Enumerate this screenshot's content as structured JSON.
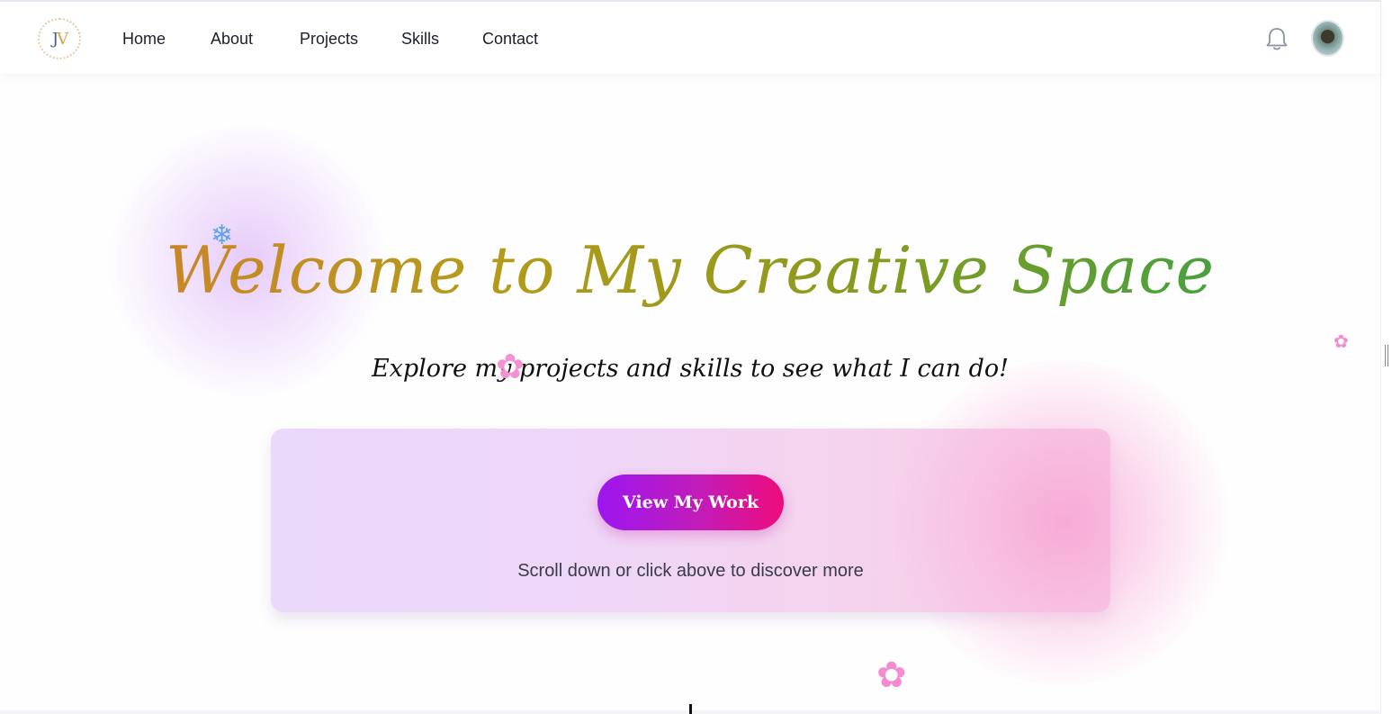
{
  "navbar": {
    "logo_text_j": "J",
    "logo_text_v": "V",
    "links": [
      {
        "label": "Home"
      },
      {
        "label": "About"
      },
      {
        "label": "Projects"
      },
      {
        "label": "Skills"
      },
      {
        "label": "Contact"
      }
    ],
    "notification_icon": "bell-icon",
    "avatar_icon": "user-avatar"
  },
  "hero": {
    "title": "Welcome to My Creative Space",
    "subtitle": "Explore my projects and skills to see what I can do!"
  },
  "cta": {
    "button_label": "View My Work",
    "hint": "Scroll down or click above to discover more"
  },
  "decorations": {
    "snowflake": "❄",
    "flower": "✿"
  },
  "colors": {
    "title_gradient_start": "#d27c2e",
    "title_gradient_end": "#3aa04a",
    "button_gradient_start": "#9b16f0",
    "button_gradient_end": "#ee0c7a",
    "card_gradient_start": "#ead9fb",
    "card_gradient_end": "#f9c9e3"
  }
}
